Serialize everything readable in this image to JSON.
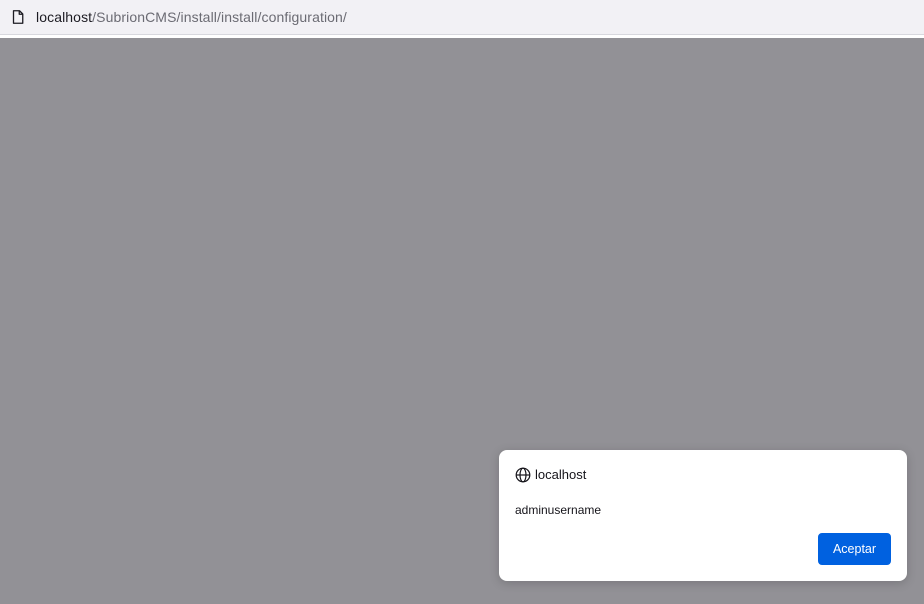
{
  "urlbar": {
    "host": "localhost",
    "path": "/SubrionCMS/install/install/configuration/",
    "page_icon": "document-icon"
  },
  "dialog": {
    "origin_icon": "globe-icon",
    "origin": "localhost",
    "message": "adminusername",
    "ok_label": "Aceptar"
  },
  "colors": {
    "overlay": "#929196",
    "urlbar_bg": "#f2f1f5",
    "button_bg": "#0061e0",
    "button_text": "#ffffff"
  }
}
